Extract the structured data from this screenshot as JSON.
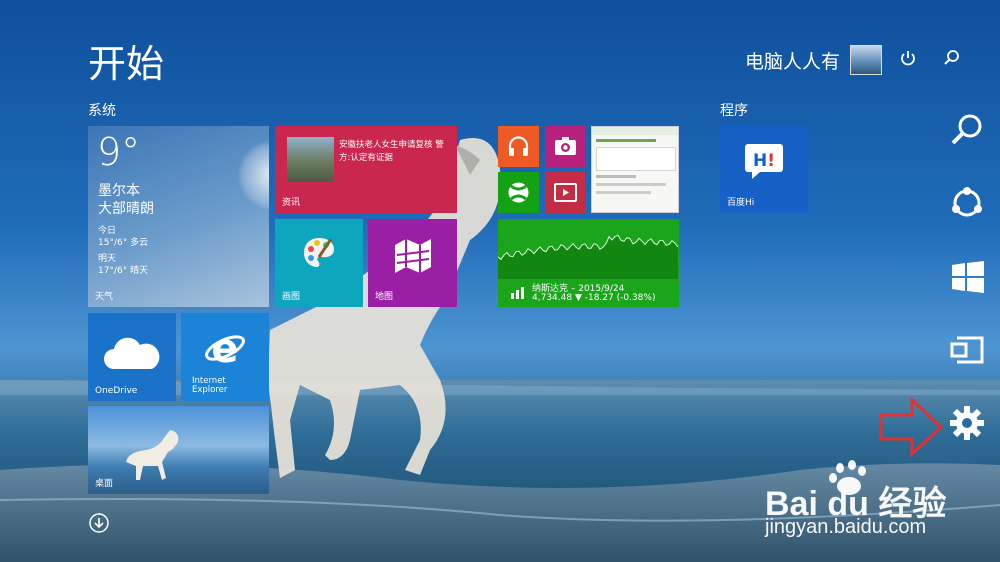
{
  "start": {
    "title": "开始",
    "user_name": "电脑人人有",
    "group_system": "系统",
    "group_programs": "程序"
  },
  "tiles": {
    "weather": {
      "temp": "9°",
      "city": "墨尔本",
      "condition": "大部晴朗",
      "today_label": "今日",
      "today_forecast": "15°/6° 多云",
      "tomorrow_label": "明天",
      "tomorrow_forecast": "17°/6° 晴天",
      "label": "天气"
    },
    "news": {
      "headline": "安徽扶老人女生申请复核 警方:认定有证据",
      "label": "资讯"
    },
    "paint": {
      "label": "画图"
    },
    "maps": {
      "label": "地图"
    },
    "finance": {
      "title": "纳斯达克 – 2015/9/24",
      "value": "4,734.48 ▼ -18.27 (-0.38%)"
    },
    "onedrive": {
      "label": "OneDrive"
    },
    "ie": {
      "label": "Internet Explorer"
    },
    "desktop": {
      "label": "桌面"
    },
    "baiduhi": {
      "label": "百度Hi"
    }
  },
  "charms": [
    "search-charm",
    "share-charm",
    "start-charm",
    "devices-charm",
    "settings-charm"
  ],
  "watermark": {
    "text": "Bai du 经验",
    "url": "jingyan.baidu.com"
  },
  "colors": {
    "weather_tile": "#4f86c1",
    "news_tile": "#c9274d",
    "paint_tile": "#0ea5bf",
    "maps_tile": "#9a1fa4",
    "music_tile": "#ef5a24",
    "photo_tile": "#b8207d",
    "games_tile": "#14a114",
    "video_tile": "#c42b44",
    "finance_tile": "#1ba51b",
    "onedrive_tile": "#1b72c9",
    "ie_tile": "#1b83d8",
    "baiduhi_tile": "#1660c8",
    "arrow": "#e53030"
  }
}
